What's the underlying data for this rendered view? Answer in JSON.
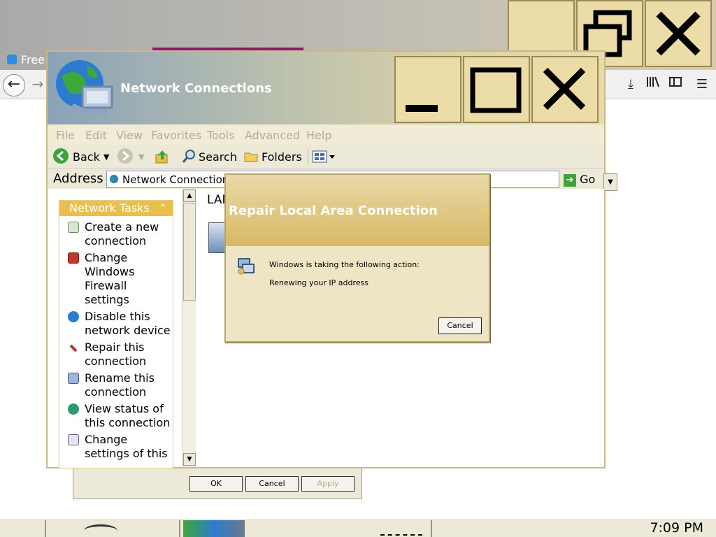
{
  "background_browser": {
    "tab_label": "Free",
    "toolbar_icons": [
      "download-icon",
      "library-icon",
      "sidebar-icon",
      "menu-icon"
    ],
    "caption_buttons": [
      "restore-icon",
      "close-icon"
    ]
  },
  "explorer": {
    "title": "Network Connections",
    "menu": [
      "File",
      "Edit",
      "View",
      "Favorites",
      "Tools",
      "Advanced",
      "Help"
    ],
    "toolbar": {
      "back": "Back",
      "search": "Search",
      "folders": "Folders"
    },
    "address": {
      "label": "Address",
      "value": "Network Connections",
      "go": "Go"
    },
    "task_panel": {
      "header": "Network Tasks",
      "items": [
        {
          "label": "Create a new connection",
          "icon": "new-connection-icon"
        },
        {
          "label": "Change Windows Firewall settings",
          "icon": "firewall-icon"
        },
        {
          "label": "Disable this network device",
          "icon": "disable-network-icon"
        },
        {
          "label": "Repair this connection",
          "icon": "repair-icon"
        },
        {
          "label": "Rename this connection",
          "icon": "rename-icon"
        },
        {
          "label": "View status of this connection",
          "icon": "status-icon"
        },
        {
          "label": "Change settings of this",
          "icon": "settings-icon"
        }
      ]
    },
    "content_heading": "LAN"
  },
  "back_dialog": {
    "ok": "OK",
    "cancel": "Cancel",
    "apply": "Apply"
  },
  "repair_dialog": {
    "title": "Repair Local Area Connection",
    "line1": "Windows is taking the following action:",
    "line2": "Renewing your IP address",
    "cancel": "Cancel"
  },
  "taskbar": {
    "clock": "7:09 PM"
  },
  "colors": {
    "task_header": "#e8c04a",
    "dialog_title": "#d7b865",
    "caption_button": "#ecdca8"
  }
}
